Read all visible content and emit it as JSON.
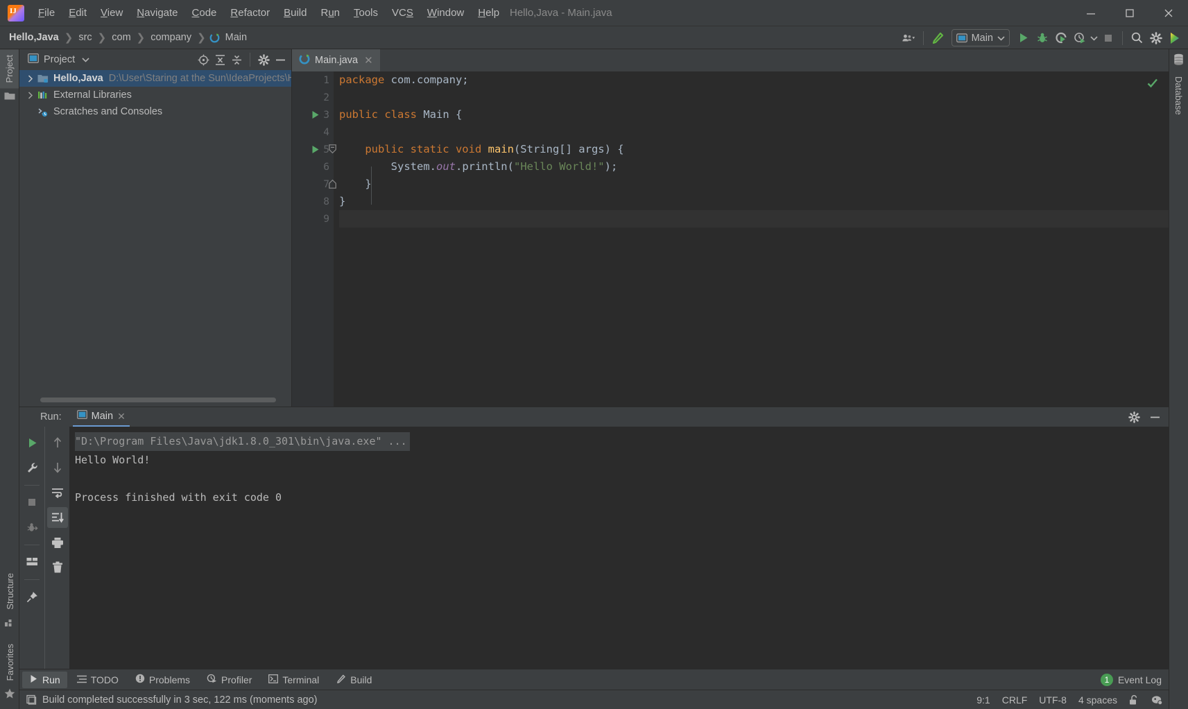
{
  "window": {
    "title": "Hello,Java - Main.java",
    "logo_icon": "intellij-idea-logo",
    "minimize_icon": "minimize-icon",
    "maximize_icon": "maximize-icon",
    "close_icon": "close-icon"
  },
  "menu": [
    {
      "label": "File",
      "mnemonic": "F"
    },
    {
      "label": "Edit",
      "mnemonic": "E"
    },
    {
      "label": "View",
      "mnemonic": "V"
    },
    {
      "label": "Navigate",
      "mnemonic": "N"
    },
    {
      "label": "Code",
      "mnemonic": "C"
    },
    {
      "label": "Refactor",
      "mnemonic": "R"
    },
    {
      "label": "Build",
      "mnemonic": "B"
    },
    {
      "label": "Run",
      "mnemonic": "u"
    },
    {
      "label": "Tools",
      "mnemonic": "T"
    },
    {
      "label": "VCS",
      "mnemonic": "S"
    },
    {
      "label": "Window",
      "mnemonic": "W"
    },
    {
      "label": "Help",
      "mnemonic": "H"
    }
  ],
  "breadcrumbs": [
    {
      "label": "Hello,Java",
      "bold": true
    },
    {
      "label": "src",
      "bold": false
    },
    {
      "label": "com",
      "bold": false
    },
    {
      "label": "company",
      "bold": false
    },
    {
      "label": "Main",
      "bold": false,
      "icon": "java-class-icon"
    }
  ],
  "toolbar": {
    "account_icon": "account-icon",
    "account_caret": "chevron-down-icon",
    "build_icon": "build-hammer-icon",
    "run_config": {
      "icon": "run-config-icon",
      "label": "Main",
      "caret_icon": "chevron-down-icon"
    },
    "run_icon": "run-play-icon",
    "debug_icon": "debug-bug-icon",
    "run_coverage_icon": "run-with-coverage-icon",
    "profiler_icon": "profiler-icon",
    "profiler_caret": "chevron-down-icon",
    "stop_icon": "stop-icon",
    "search_icon": "search-everywhere-icon",
    "settings_icon": "gear-icon",
    "ide_help_icon": "idea-assistant-icon"
  },
  "left_stripe": [
    {
      "label": "Project",
      "icon": "project-tool-icon",
      "active": true
    },
    {
      "label": "Structure",
      "icon": "structure-tool-icon",
      "active": false
    },
    {
      "label": "Favorites",
      "icon": "favorites-star-icon",
      "active": false
    }
  ],
  "right_stripe": [
    {
      "label": "Database",
      "icon": "database-icon",
      "active": false
    }
  ],
  "project_panel": {
    "title": "Project",
    "title_icon": "project-view-icon",
    "title_caret": "chevron-down-icon",
    "tools": [
      {
        "name": "select-opened-file-icon"
      },
      {
        "name": "expand-all-icon"
      },
      {
        "name": "collapse-all-icon"
      },
      {
        "name": "gear-icon"
      },
      {
        "name": "hide-icon"
      }
    ],
    "tree": [
      {
        "label": "Hello,Java",
        "path": "D:\\User\\Staring at the Sun\\IdeaProjects\\H",
        "icon": "project-module-icon",
        "arrow": "chevron-right-icon",
        "selected": true,
        "indent": 0
      },
      {
        "label": "External Libraries",
        "path": "",
        "icon": "libraries-icon",
        "arrow": "chevron-right-icon",
        "selected": false,
        "indent": 0
      },
      {
        "label": "Scratches and Consoles",
        "path": "",
        "icon": "scratches-icon",
        "arrow": "",
        "selected": false,
        "indent": 0
      }
    ]
  },
  "editor": {
    "tabs": [
      {
        "label": "Main.java",
        "icon": "java-class-icon",
        "close_icon": "close-icon",
        "active": true
      }
    ],
    "inspection_status_icon": "checkmark-ok-icon",
    "lines": [
      {
        "n": "1",
        "runmark": false,
        "fold": "",
        "tokens": [
          {
            "t": "package ",
            "c": "k"
          },
          {
            "t": "com.company;",
            "c": "p"
          }
        ]
      },
      {
        "n": "2",
        "runmark": false,
        "fold": "",
        "tokens": []
      },
      {
        "n": "3",
        "runmark": true,
        "fold": "",
        "tokens": [
          {
            "t": "public class ",
            "c": "k"
          },
          {
            "t": "Main ",
            "c": "p"
          },
          {
            "t": "{",
            "c": "p"
          }
        ]
      },
      {
        "n": "4",
        "runmark": false,
        "fold": "",
        "tokens": []
      },
      {
        "n": "5",
        "runmark": true,
        "fold": "open",
        "tokens": [
          {
            "t": "    ",
            "c": "p"
          },
          {
            "t": "public static void ",
            "c": "k"
          },
          {
            "t": "main",
            "c": "f"
          },
          {
            "t": "(String[] args) {",
            "c": "p"
          }
        ]
      },
      {
        "n": "6",
        "runmark": false,
        "fold": "",
        "tokens": [
          {
            "t": "        System.",
            "c": "p"
          },
          {
            "t": "out",
            "c": "i"
          },
          {
            "t": ".println(",
            "c": "p"
          },
          {
            "t": "\"Hello World!\"",
            "c": "s"
          },
          {
            "t": ");",
            "c": "p"
          }
        ]
      },
      {
        "n": "7",
        "runmark": false,
        "fold": "close",
        "tokens": [
          {
            "t": "    }",
            "c": "p"
          }
        ]
      },
      {
        "n": "8",
        "runmark": false,
        "fold": "",
        "tokens": [
          {
            "t": "}",
            "c": "p"
          }
        ]
      },
      {
        "n": "9",
        "runmark": false,
        "fold": "",
        "tokens": [],
        "caret": true
      }
    ]
  },
  "run_panel": {
    "run_label": "Run:",
    "tab": {
      "label": "Main",
      "icon": "run-config-icon",
      "close_icon": "close-icon"
    },
    "header_tools": [
      {
        "name": "gear-icon"
      },
      {
        "name": "hide-icon"
      }
    ],
    "side_tools": [
      {
        "name": "rerun-icon",
        "selected": false
      },
      {
        "name": "wrench-settings-icon",
        "selected": false
      },
      {
        "name": "stop-icon",
        "selected": false
      },
      {
        "name": "detach-debug-icon",
        "selected": false
      },
      {
        "name": "layout-icon",
        "selected": false
      },
      {
        "name": "pin-icon",
        "selected": false
      }
    ],
    "side_tools2": [
      {
        "name": "up-arrow-icon",
        "selected": false
      },
      {
        "name": "down-arrow-icon",
        "selected": false
      },
      {
        "name": "soft-wrap-icon",
        "selected": false
      },
      {
        "name": "scroll-to-end-icon",
        "selected": true
      },
      {
        "name": "print-icon",
        "selected": false
      },
      {
        "name": "trash-icon",
        "selected": false
      }
    ],
    "console": [
      {
        "text": "\"D:\\Program Files\\Java\\jdk1.8.0_301\\bin\\java.exe\" ...",
        "kind": "cmd"
      },
      {
        "text": "Hello World!",
        "kind": "out"
      },
      {
        "text": "",
        "kind": "out"
      },
      {
        "text": "Process finished with exit code 0",
        "kind": "out"
      }
    ]
  },
  "bottom_bar": {
    "items": [
      {
        "label": "Run",
        "icon": "run-play-icon",
        "active": true
      },
      {
        "label": "TODO",
        "icon": "todo-list-icon",
        "active": false
      },
      {
        "label": "Problems",
        "icon": "problems-icon",
        "active": false
      },
      {
        "label": "Profiler",
        "icon": "profiler-icon",
        "active": false
      },
      {
        "label": "Terminal",
        "icon": "terminal-icon",
        "active": false
      },
      {
        "label": "Build",
        "icon": "build-hammer-icon",
        "active": false
      }
    ],
    "event_log": {
      "count": "1",
      "label": "Event Log"
    }
  },
  "status_bar": {
    "icon": "status-memory-icon",
    "message": "Build completed successfully in 3 sec, 122 ms (moments ago)",
    "caret_position": "9:1",
    "line_separator": "CRLF",
    "encoding": "UTF-8",
    "indent": "4 spaces",
    "lock_icon": "unlocked-icon",
    "inspection_icon": "inspection-profile-icon"
  },
  "colors": {
    "chrome": "#3c3f41",
    "editor_bg": "#2b2b2b",
    "gutter_bg": "#313335",
    "selection": "#2f4e6e",
    "accent_green": "#499c54",
    "keyword": "#cc7832",
    "string": "#6a8759",
    "method": "#ffc66d",
    "static_field": "#9876aa",
    "text": "#a9b7c6"
  }
}
